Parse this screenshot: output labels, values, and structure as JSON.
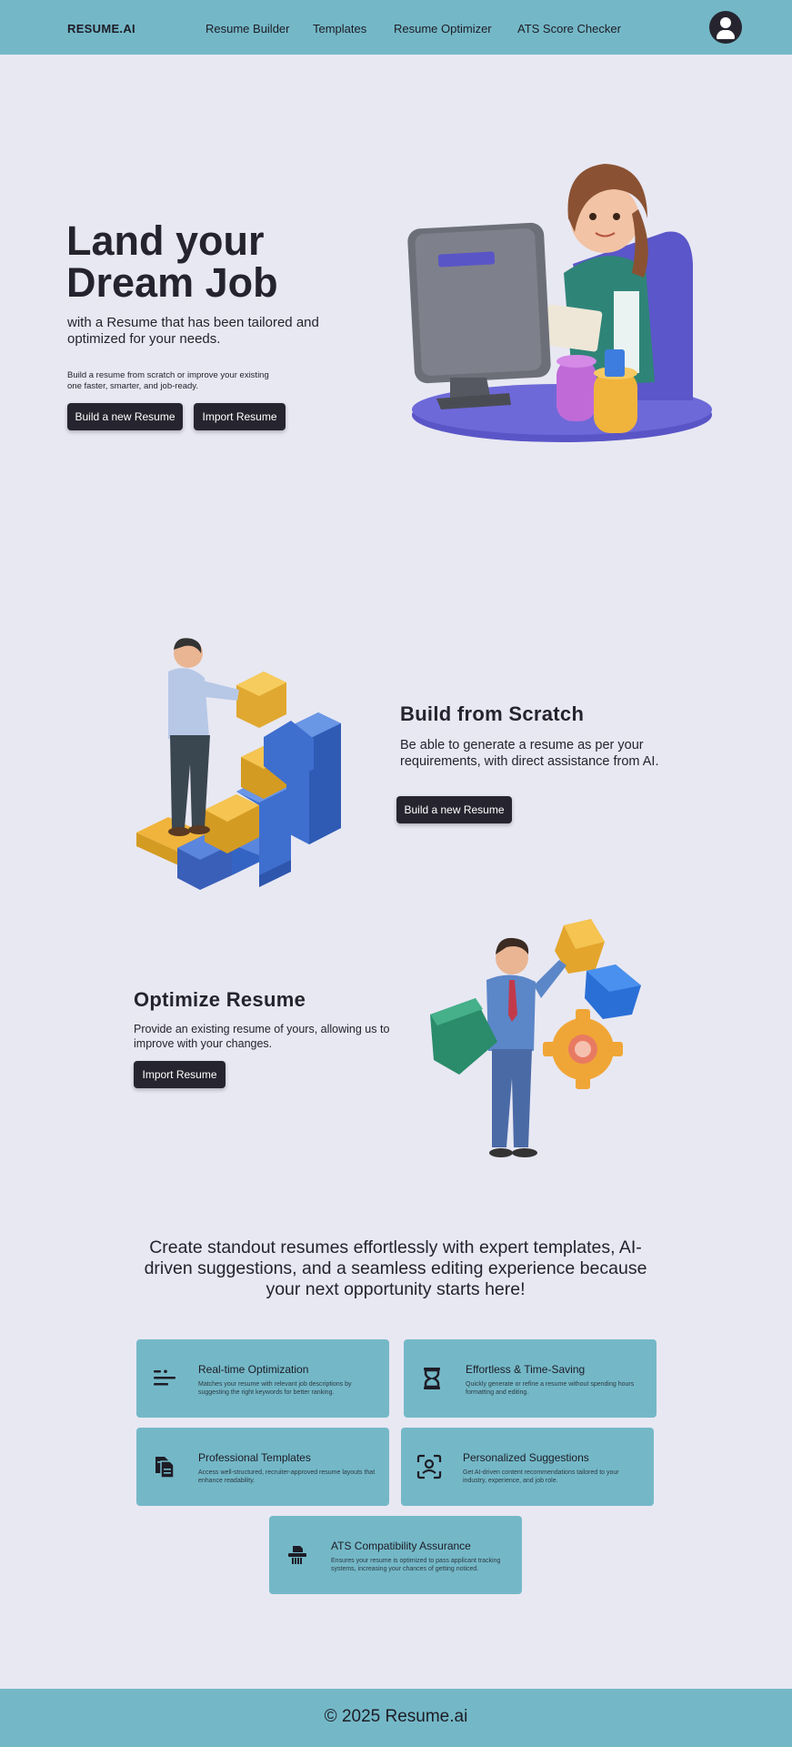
{
  "nav": {
    "brand": "RESUME.AI",
    "links": [
      "Resume Builder",
      "Templates",
      "Resume Optimizer",
      "ATS Score Checker"
    ]
  },
  "hero": {
    "title_line1": "Land your",
    "title_line2": "Dream Job",
    "subtitle": "with a Resume that has been tailored and optimized for your needs.",
    "small": "Build a resume from scratch or improve your existing one faster, smarter, and job-ready.",
    "btn_build": "Build a new Resume",
    "btn_import": "Import Resume"
  },
  "scratch": {
    "title": "Build from Scratch",
    "text": "Be able to generate a resume as per your requirements, with direct assistance from AI.",
    "btn": "Build a new Resume"
  },
  "optimize": {
    "title": "Optimize Resume",
    "text": "Provide an existing resume of yours, allowing us to improve with your changes.",
    "btn": "Import Resume"
  },
  "tagline": "Create standout resumes effortlessly with expert templates, AI-driven suggestions, and a seamless editing experience because your next opportunity starts here!",
  "features": [
    {
      "icon": "text-lines-icon",
      "title": "Real-time Optimization",
      "desc": "Matches your resume with relevant job descriptions by suggesting the right keywords for better ranking."
    },
    {
      "icon": "hourglass-icon",
      "title": "Effortless & Time-Saving",
      "desc": "Quickly generate or refine a resume without spending hours formatting and editing."
    },
    {
      "icon": "documents-icon",
      "title": "Professional Templates",
      "desc": "Access well-structured, recruiter-approved resume layouts that enhance readability."
    },
    {
      "icon": "face-scan-icon",
      "title": "Personalized Suggestions",
      "desc": "Get AI-driven content recommendations tailored to your industry, experience, and job role."
    },
    {
      "icon": "shredder-icon",
      "title": "ATS Compatibility Assurance",
      "desc": "Ensures your resume is optimized to pass applicant tracking systems, increasing your chances of getting noticed."
    }
  ],
  "footer": "© 2025 Resume.ai",
  "colors": {
    "background": "#e8e8f3",
    "bar": "#74b8c7",
    "button": "#26252f"
  }
}
